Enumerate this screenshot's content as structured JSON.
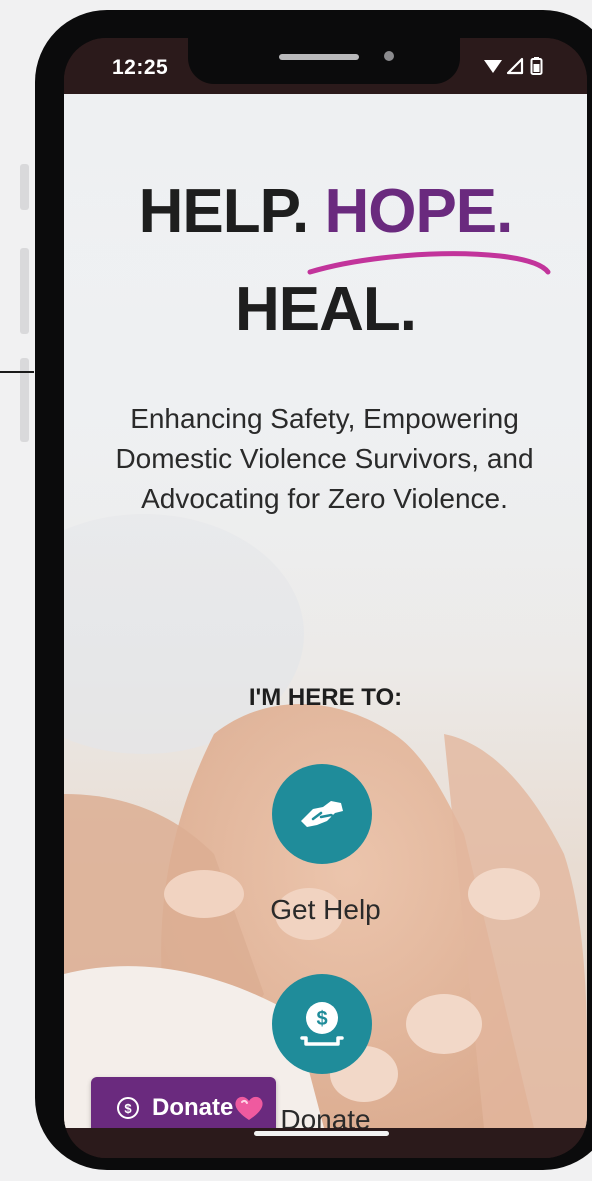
{
  "status_bar": {
    "time": "12:25",
    "icons": [
      "wifi-icon",
      "signal-icon",
      "battery-icon"
    ]
  },
  "hero": {
    "title_part1": "HELP.",
    "title_part2": "HOPE.",
    "title_part3": "HEAL."
  },
  "tagline": "Enhancing Safety, Empowering Domestic Violence Survivors, and Advocating for Zero Violence.",
  "section_label": "I'M HERE TO:",
  "actions": [
    {
      "label": "Get Help",
      "icon": "handshake-icon"
    },
    {
      "label": "Donate",
      "icon": "donation-icon"
    }
  ],
  "floating_donate": {
    "label": "Donate",
    "icon": "dollar-circle-icon",
    "badge": "heart-icon"
  },
  "colors": {
    "accent_purple": "#6a2a7e",
    "accent_pink": "#c2349b",
    "teal": "#1f8c9a"
  }
}
